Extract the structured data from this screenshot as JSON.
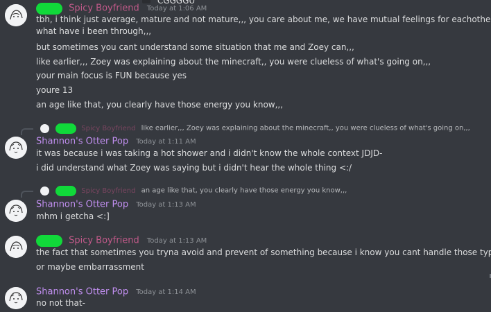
{
  "top_fragment": "CGGGGU",
  "messages": [
    {
      "id": "m1",
      "author": "Spicy Boyfriend",
      "timestamp": "Today at 1:06 AM",
      "lines": [
        "tbh, i think just average, mature and not mature,,, you care about me, we have mutual feelings for eachother, you understand",
        "what have i been through,,,",
        "but sometimes you cant understand some situation that me and Zoey can,,,",
        "like earlier,,, Zoey was explaining about the minecraft,, you were clueless of what's going on,,,",
        "your main focus is FUN because yes",
        "youre 13",
        "an age like that, you clearly have those energy you know,,,"
      ]
    },
    {
      "id": "m2",
      "reply": {
        "author": "Spicy Boyfriend",
        "text": "like earlier,,, Zoey was explaining about the minecraft,, you were clueless of what's going on,,,"
      },
      "author": "Shannon's Otter Pop",
      "timestamp": "Today at 1:11 AM",
      "lines": [
        "it was because i was taking a hot shower and i didn't know the whole context JDJD-",
        "i did understand what Zoey was saying but i didn't hear the whole thing <:/"
      ]
    },
    {
      "id": "m3",
      "reply": {
        "author": "Spicy Boyfriend",
        "text": "an age like that, you clearly have those energy you know,,,"
      },
      "author": "Shannon's Otter Pop",
      "timestamp": "Today at 1:13 AM",
      "lines": [
        "mhm i getcha <:]"
      ]
    },
    {
      "id": "m4",
      "author": "Spicy Boyfriend",
      "timestamp": "Today at 1:13 AM",
      "lines": [
        "the fact that sometimes you tryna avoid and prevent of something because i know you cant handle those type of things",
        "or maybe embarrassment"
      ]
    },
    {
      "id": "m5",
      "author": "Shannon's Otter Pop",
      "timestamp": "Today at 1:14 AM",
      "lines": [
        "no not that-"
      ]
    }
  ],
  "colors": {
    "background": "#36393f",
    "spicy_name": "#c25a8a",
    "otter_name": "#c18ff0",
    "redaction_blob": "#11d93a",
    "text": "#dcddde",
    "timestamp": "#8e9297"
  }
}
